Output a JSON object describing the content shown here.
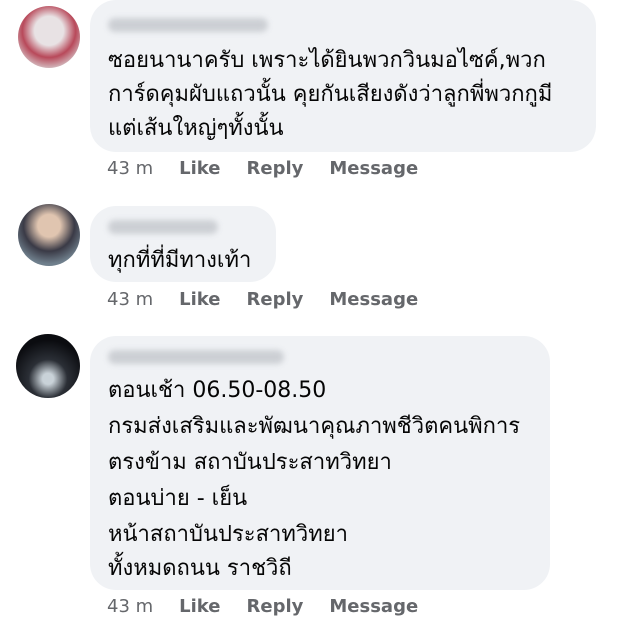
{
  "comments": [
    {
      "author": "Sharavut Madee",
      "lines": [
        "ซอยนานาครับ เพราะได้ยินพวกวินมอไซค์,พวก",
        "การ์ดคุมผับแถวนั้น คุยกันเสียงดังว่าลูกพี่พวกกูมี",
        "แต่เส้นใหญ่ๆทั้งนั้น"
      ],
      "timestamp": "43 m",
      "actions": [
        "Like",
        "Reply",
        "Message"
      ]
    },
    {
      "author": "Arm Amadeo",
      "lines": [
        "ทุกที่ที่มีทางเท้า"
      ],
      "timestamp": "43 m",
      "actions": [
        "Like",
        "Reply",
        "Message"
      ]
    },
    {
      "author": "Suerat suudiendiel",
      "lines": [
        "ตอนเช้า 06.50-08.50",
        "กรมส่งเสริมและพัฒนาคุณภาพชีวิตคนพิการ",
        "ตรงข้าม สถาบันประสาทวิทยา",
        "ตอนบ่าย - เย็น",
        "หน้าสถาบันประสาทวิทยา",
        "ทั้งหมดถนน ราชวิถี"
      ],
      "timestamp": "43 m",
      "actions": [
        "Like",
        "Reply",
        "Message"
      ]
    }
  ],
  "colors": {
    "bubble": "#f0f2f5",
    "text": "#050505",
    "meta": "#65676b"
  }
}
